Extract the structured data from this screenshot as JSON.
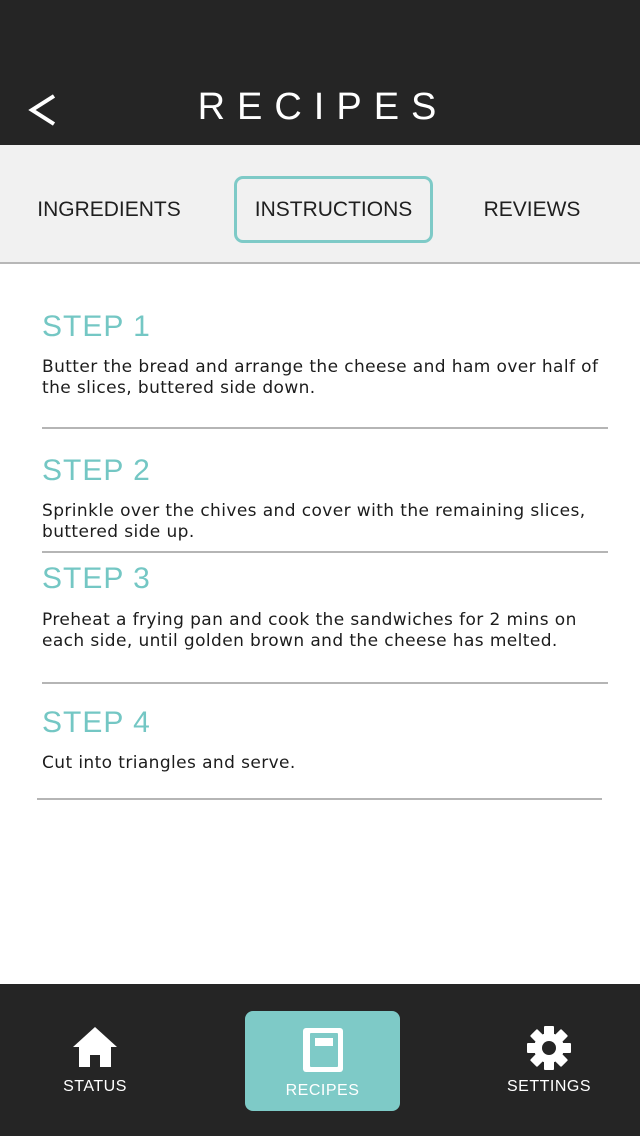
{
  "header": {
    "title": "RECIPES",
    "back_icon": "chevron-left-icon"
  },
  "tabs": [
    {
      "label": "INGREDIENTS",
      "active": false
    },
    {
      "label": "INSTRUCTIONS",
      "active": true
    },
    {
      "label": "REVIEWS",
      "active": false
    }
  ],
  "steps": [
    {
      "title": "STEP 1",
      "text": "Butter the bread and arrange the cheese and ham over half of the slices, buttered side down."
    },
    {
      "title": "STEP 2",
      "text": "Sprinkle over the chives and cover with the remaining slices, buttered side up."
    },
    {
      "title": "STEP 3",
      "text": "Preheat a frying pan and cook the sandwiches for 2 mins on each side, until golden brown and the cheese has melted."
    },
    {
      "title": "STEP 4",
      "text": "Cut into triangles and serve."
    }
  ],
  "bottom_nav": [
    {
      "label": "STATUS",
      "icon": "home-icon",
      "active": false
    },
    {
      "label": "RECIPES",
      "icon": "book-icon",
      "active": true
    },
    {
      "label": "SETTINGS",
      "icon": "gear-icon",
      "active": false
    }
  ],
  "colors": {
    "header_bg": "#252525",
    "accent": "#7ecac7",
    "step_title": "#74c7c4",
    "tab_bar_bg": "#f1f1f1"
  }
}
